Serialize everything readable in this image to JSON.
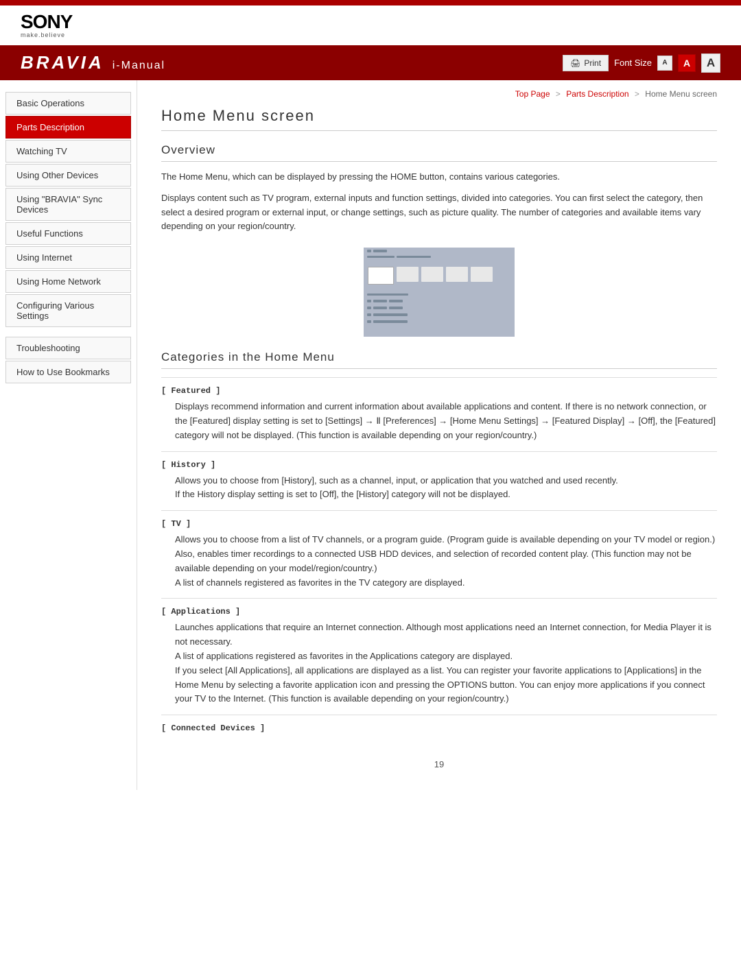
{
  "topBar": {},
  "header": {
    "sonyLogo": "SONY",
    "tagline": "make.believe"
  },
  "brandBar": {
    "bravia": "BRAVIA",
    "imanual": "i-Manual",
    "printLabel": "Print",
    "fontSizeLabel": "Font Size",
    "fontSmall": "A",
    "fontMedium": "A",
    "fontLarge": "A"
  },
  "breadcrumb": {
    "topPage": "Top Page",
    "partsDescription": "Parts Description",
    "current": "Home Menu screen",
    "sep1": ">",
    "sep2": ">"
  },
  "sidebar": {
    "items": [
      {
        "id": "basic-operations",
        "label": "Basic Operations",
        "active": false
      },
      {
        "id": "parts-description",
        "label": "Parts Description",
        "active": true
      },
      {
        "id": "watching-tv",
        "label": "Watching TV",
        "active": false
      },
      {
        "id": "using-other-devices",
        "label": "Using Other Devices",
        "active": false
      },
      {
        "id": "using-bravia-sync",
        "label": "Using \"BRAVIA\" Sync Devices",
        "active": false
      },
      {
        "id": "useful-functions",
        "label": "Useful Functions",
        "active": false
      },
      {
        "id": "using-internet",
        "label": "Using Internet",
        "active": false
      },
      {
        "id": "using-home-network",
        "label": "Using Home Network",
        "active": false
      },
      {
        "id": "configuring-various-settings",
        "label": "Configuring Various Settings",
        "active": false
      }
    ],
    "items2": [
      {
        "id": "troubleshooting",
        "label": "Troubleshooting",
        "active": false
      },
      {
        "id": "how-to-use-bookmarks",
        "label": "How to Use Bookmarks",
        "active": false
      }
    ]
  },
  "content": {
    "pageTitle": "Home Menu screen",
    "overviewTitle": "Overview",
    "overviewPara1": "The Home Menu, which can be displayed by pressing the HOME button, contains various categories.",
    "overviewPara2": "Displays content such as TV program, external inputs and function settings, divided into categories. You can first select the category, then select a desired program or external input, or change settings, such as picture quality. The number of categories and available items vary depending on your region/country.",
    "categoriesTitle": "Categories in the Home Menu",
    "categories": [
      {
        "label": "[ Featured ]",
        "text": "Displays recommend information and current information about available applications and content. If there is no network connection, or the [Featured] display setting is set to [Settings] → Ⅱ [Preferences] → [Home Menu Settings] → [Featured Display] → [Off], the [Featured] category will not be displayed. (This function is available depending on your region/country.)"
      },
      {
        "label": "[ History ]",
        "text": "Allows you to choose from [History], such as a channel, input, or application that you watched and used recently.\nIf the History display setting is set to [Off], the [History] category will not be displayed."
      },
      {
        "label": "[ TV ]",
        "text": "Allows you to choose from a list of TV channels, or a program guide. (Program guide is available depending on your TV model or region.)\nAlso, enables timer recordings to a connected USB HDD devices, and selection of recorded content play. (This function may not be available depending on your model/region/country.)\nA list of channels registered as favorites in the TV category are displayed."
      },
      {
        "label": "[ Applications ]",
        "text": "Launches applications that require an Internet connection. Although most applications need an Internet connection, for Media Player it is not necessary.\nA list of applications registered as favorites in the Applications category are displayed.\nIf you select [All Applications], all applications are displayed as a list. You can register your favorite applications to [Applications] in the Home Menu by selecting a favorite application icon and pressing the OPTIONS button. You can enjoy more applications if you connect your TV to the Internet. (This function is available depending on your region/country.)"
      },
      {
        "label": "[ Connected Devices ]",
        "text": ""
      }
    ],
    "pageNumber": "19"
  }
}
